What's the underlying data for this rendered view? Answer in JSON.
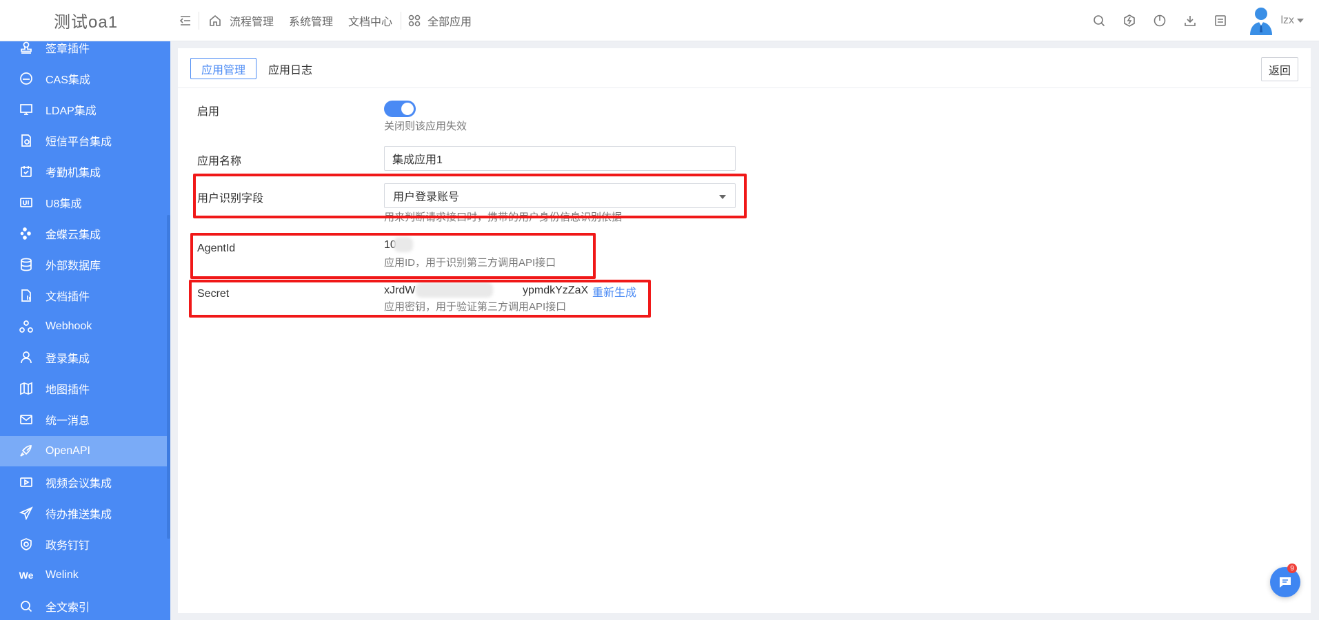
{
  "app": {
    "title": "测试oa1"
  },
  "header": {
    "nav": [
      "流程管理",
      "系统管理",
      "文档中心"
    ],
    "all_apps": "全部应用",
    "user": "lzx"
  },
  "sidebar": {
    "items": [
      {
        "label": "签章插件",
        "icon": "stamp-icon"
      },
      {
        "label": "CAS集成",
        "icon": "cas-icon"
      },
      {
        "label": "LDAP集成",
        "icon": "ldap-icon"
      },
      {
        "label": "短信平台集成",
        "icon": "sms-icon"
      },
      {
        "label": "考勤机集成",
        "icon": "attendance-icon"
      },
      {
        "label": "U8集成",
        "icon": "u8-icon"
      },
      {
        "label": "金蝶云集成",
        "icon": "kingdee-icon"
      },
      {
        "label": "外部数据库",
        "icon": "database-icon"
      },
      {
        "label": "文档插件",
        "icon": "document-plugin-icon"
      },
      {
        "label": "Webhook",
        "icon": "webhook-icon"
      },
      {
        "label": "登录集成",
        "icon": "user-icon"
      },
      {
        "label": "地图插件",
        "icon": "map-icon"
      },
      {
        "label": "统一消息",
        "icon": "mail-icon"
      },
      {
        "label": "OpenAPI",
        "icon": "rocket-icon",
        "active": true
      },
      {
        "label": "视频会议集成",
        "icon": "video-icon"
      },
      {
        "label": "待办推送集成",
        "icon": "send-icon"
      },
      {
        "label": "政务钉钉",
        "icon": "shield-icon"
      },
      {
        "label": "Welink",
        "icon": "welink-icon",
        "icon_text": "We"
      },
      {
        "label": "全文索引",
        "icon": "search-icon"
      }
    ]
  },
  "tabs": {
    "active": "应用管理",
    "log": "应用日志",
    "back": "返回"
  },
  "form": {
    "enable_label": "启用",
    "enable_hint": "关闭则该应用失效",
    "enabled": true,
    "name_label": "应用名称",
    "name_value": "集成应用1",
    "user_field_label": "用户识别字段",
    "user_field_value": "用户登录账号",
    "user_field_hint": "用来判断请求接口时，携带的用户身份信息识别依据",
    "agent_label": "AgentId",
    "agent_value": "10",
    "agent_hint": "应用ID，用于识别第三方调用API接口",
    "secret_label": "Secret",
    "secret_prefix": "xJrdW",
    "secret_suffix": "ypmdkYzZaX",
    "regenerate": "重新生成",
    "secret_hint": "应用密钥，用于验证第三方调用API接口"
  },
  "chat": {
    "badge": "9"
  },
  "colors": {
    "accent": "#4a8af4",
    "highlight": "#f01818"
  }
}
